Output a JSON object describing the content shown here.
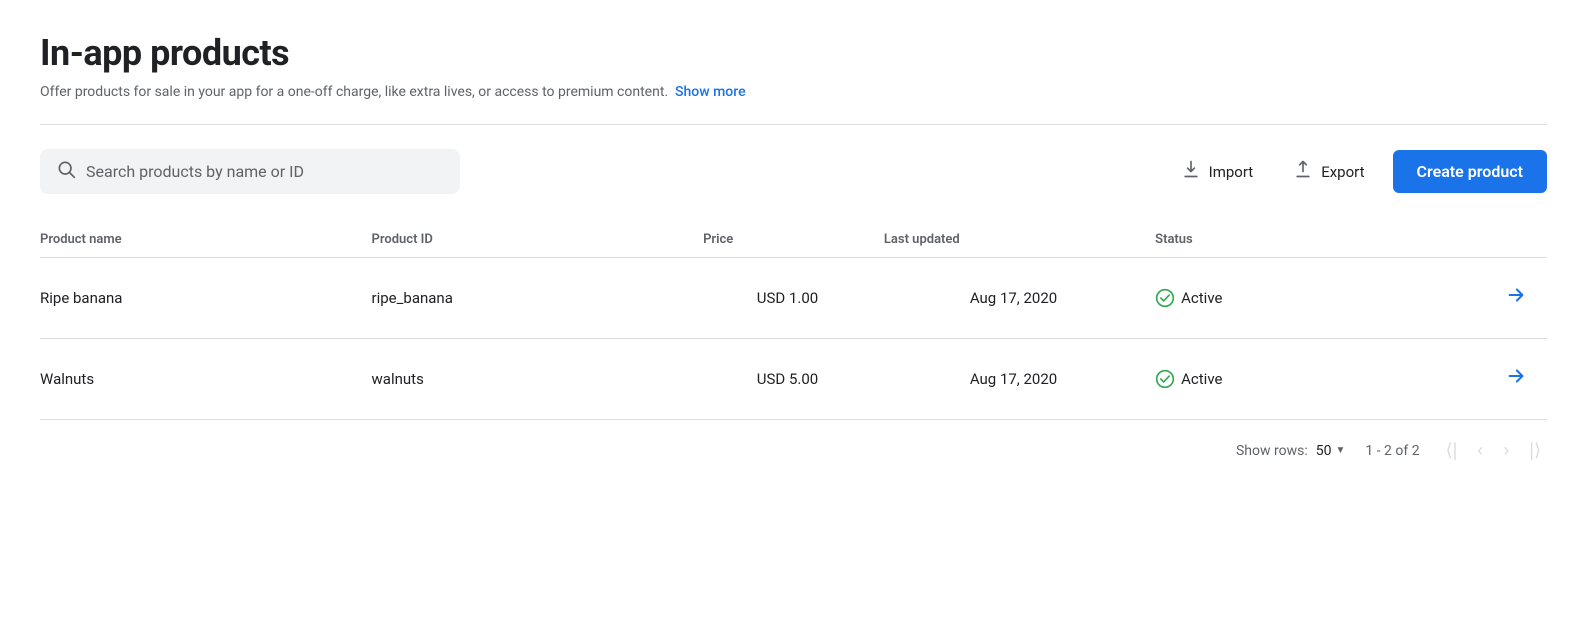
{
  "page": {
    "title": "In-app products",
    "subtitle": "Offer products for sale in your app for a one-off charge, like extra lives, or access to premium content.",
    "show_more_label": "Show more"
  },
  "toolbar": {
    "search_placeholder": "Search products by name or ID",
    "import_label": "Import",
    "export_label": "Export",
    "create_label": "Create product"
  },
  "table": {
    "columns": {
      "name": "Product name",
      "id": "Product ID",
      "price": "Price",
      "updated": "Last updated",
      "status": "Status"
    },
    "rows": [
      {
        "name": "Ripe banana",
        "id": "ripe_banana",
        "price": "USD 1.00",
        "updated": "Aug 17, 2020",
        "status": "Active"
      },
      {
        "name": "Walnuts",
        "id": "walnuts",
        "price": "USD 5.00",
        "updated": "Aug 17, 2020",
        "status": "Active"
      }
    ]
  },
  "pagination": {
    "show_rows_label": "Show rows:",
    "rows_count": "50",
    "page_info": "1 - 2 of 2"
  },
  "colors": {
    "primary": "#1a73e8",
    "active_green": "#34a853"
  }
}
